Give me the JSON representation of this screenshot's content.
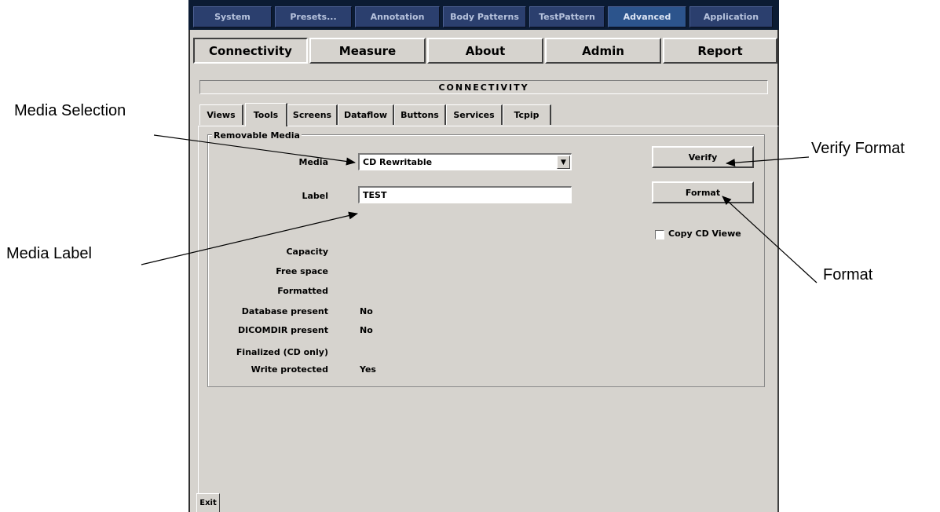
{
  "top_tabs": [
    "System",
    "Presets...",
    "Annotation",
    "Body Patterns",
    "TestPattern",
    "Advanced",
    "Application"
  ],
  "sub_tabs": [
    "Connectivity",
    "Measure",
    "About",
    "Admin",
    "Report"
  ],
  "section_header": "CONNECTIVITY",
  "panel_tabs": [
    "Views",
    "Tools",
    "Screens",
    "Dataflow",
    "Buttons",
    "Services",
    "Tcpip"
  ],
  "removable_media": {
    "group_title": "Removable Media",
    "media_label": "Media",
    "media_value": "CD Rewritable",
    "label_label": "Label",
    "label_value": "TEST",
    "verify_button": "Verify",
    "format_button": "Format",
    "copy_cd_viewer": "Copy CD Viewe",
    "props": [
      {
        "label": "Capacity",
        "value": ""
      },
      {
        "label": "Free space",
        "value": ""
      },
      {
        "label": "Formatted",
        "value": ""
      },
      {
        "label": "Database present",
        "value": "No"
      },
      {
        "label": "DICOMDIR present",
        "value": "No"
      },
      {
        "label": "Finalized (CD only)",
        "value": ""
      },
      {
        "label": "Write protected",
        "value": "Yes"
      }
    ]
  },
  "exit_button": "Exit",
  "callouts": {
    "media_selection": "Media Selection",
    "media_label": "Media Label",
    "verify_format": "Verify Format",
    "format": "Format"
  }
}
